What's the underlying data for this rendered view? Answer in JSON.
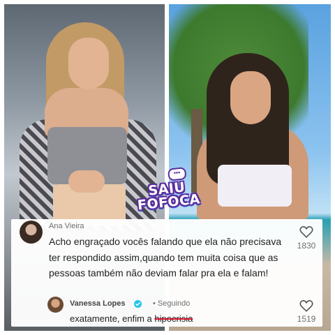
{
  "brand": {
    "line1": "SAIU",
    "line2": "FOFOCA",
    "bubble": "•••"
  },
  "comment": {
    "author": "Ana Vieira",
    "text": "Acho engraçado vocês falando que ela não precisava ter respondido assim,quando tem muita coisa que as pessoas também não deviam falar pra ela e falam!",
    "likes": "1830"
  },
  "reply": {
    "author": "Vanessa Lopes",
    "status": "• Seguindo",
    "text_prefix": "exatamente, enfim a ",
    "text_struck": "hipocrisia",
    "likes": "1519"
  },
  "icons": {
    "like": "heart-outline-icon",
    "verified": "verified-badge-icon"
  },
  "colors": {
    "verified": "#20c5e8",
    "strike": "#d0102c",
    "brand_outline": "#5a2d9e"
  }
}
